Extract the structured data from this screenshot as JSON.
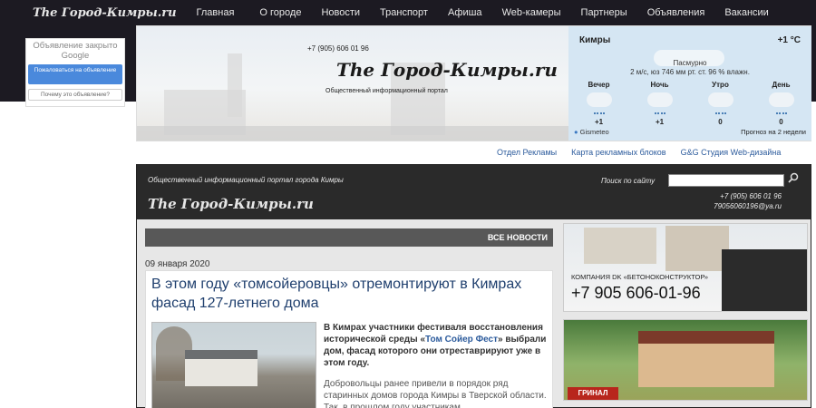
{
  "nav": {
    "logo": "The Город-Кимры.ru",
    "items": [
      "Главная",
      "О городе",
      "Новости",
      "Транспорт",
      "Афиша",
      "Web-камеры",
      "Партнеры",
      "Объявления",
      "Вакансии"
    ]
  },
  "ad_closed": {
    "text": "Объявление закрыто Google",
    "button": "Пожаловаться на объявление",
    "why": "Почему это объявление?"
  },
  "banner": {
    "phone": "+7 (905) 606 01 96",
    "logo": "The Город-Кимры.ru",
    "subtitle": "Общественный информационный портал"
  },
  "weather": {
    "city": "Кимры",
    "temp": "+1 °C",
    "condition": "Пасмурно",
    "details": "2 м/с, юз   746 мм рт. ст.   96 % влажн.",
    "periods": [
      {
        "name": "Вечер",
        "temp": "+1"
      },
      {
        "name": "Ночь",
        "temp": "+1"
      },
      {
        "name": "Утро",
        "temp": "0"
      },
      {
        "name": "День",
        "temp": "0"
      }
    ],
    "source": "Gismeteo",
    "forecast": "Прогноз на 2 недели"
  },
  "links": [
    "Отдел Рекламы",
    "Карта рекламных блоков",
    "G&G Студия Web-дизайна"
  ],
  "content_header": {
    "portal": "Общественный информационный портал города Кимры",
    "logo": "The Город-Кимры.ru",
    "search_label": "Поиск по сайту",
    "phone": "+7 (905) 606 01 96",
    "email": "79056060196@ya.ru"
  },
  "news": {
    "all_label": "ВСЕ НОВОСТИ",
    "date": "09 января 2020",
    "title": "В этом году «томсойеровцы» отремонтируют в Кимрах фасад 127-летнего дома",
    "lead_1": "В Кимрах участники фестиваля восстановления исторической среды «",
    "lead_link": "Том Сойер Фест",
    "lead_2": "» выбрали дом, фасад которого они отреставрируют уже в этом году.",
    "body": "Добровольцы ранее привели в порядок ряд старинных домов города Кимры в Тверской области. Так, в прошлом году участникам"
  },
  "ads": {
    "company": "КОМПАНИЯ DK «БЕТОНОКОНСТРУКТОР»",
    "phone": "+7 905 606-01-96",
    "ad2_logo": "ГРИНАЛ"
  }
}
